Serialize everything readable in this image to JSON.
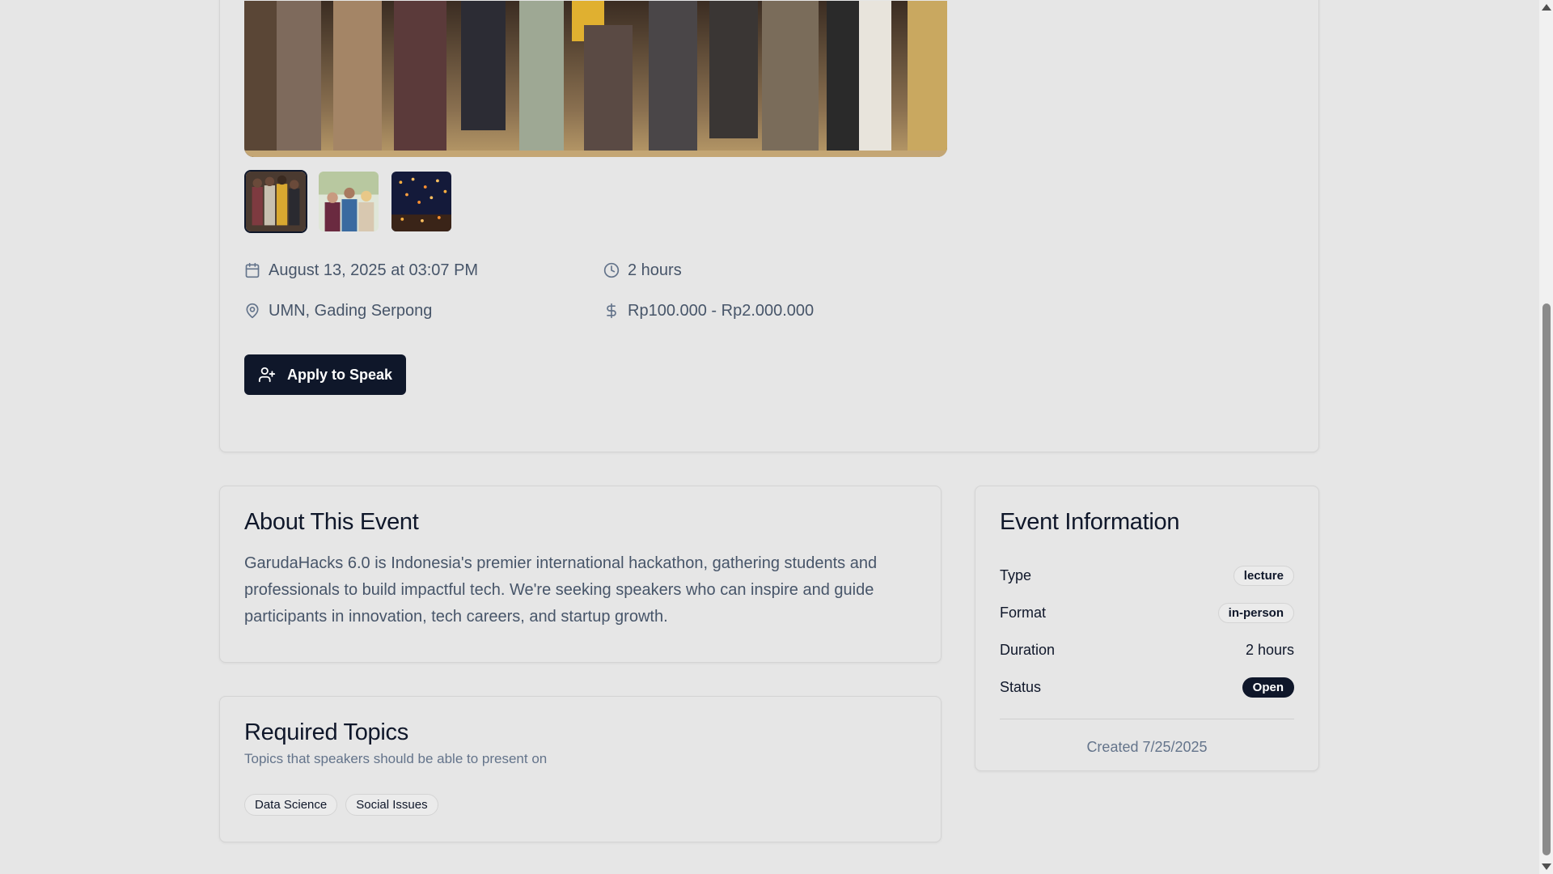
{
  "event": {
    "date": "August 13, 2025 at 03:07 PM",
    "duration": "2 hours",
    "location": "UMN, Gading Serpong",
    "price": "Rp100.000 - Rp2.000.000",
    "apply_label": "Apply to Speak"
  },
  "about": {
    "title": "About This Event",
    "text": "GarudaHacks 6.0 is Indonesia's premier international hackathon, gathering students and professionals to build impactful tech. We're seeking speakers who can inspire and guide participants in innovation, tech careers, and startup growth."
  },
  "topics": {
    "title": "Required Topics",
    "subtitle": "Topics that speakers should be able to present on",
    "items": [
      "Data Science",
      "Social Issues"
    ]
  },
  "info": {
    "title": "Event Information",
    "type_label": "Type",
    "type_value": "lecture",
    "format_label": "Format",
    "format_value": "in-person",
    "duration_label": "Duration",
    "duration_value": "2 hours",
    "status_label": "Status",
    "status_value": "Open",
    "created": "Created 7/25/2025"
  },
  "colors": {
    "primary": "#0f172a",
    "background": "#e6e6e6",
    "muted_text": "#475569"
  },
  "icons": {
    "date": "calendar-icon",
    "duration": "clock-icon",
    "location": "map-pin-icon",
    "price": "dollar-icon",
    "apply": "user-plus-icon"
  }
}
